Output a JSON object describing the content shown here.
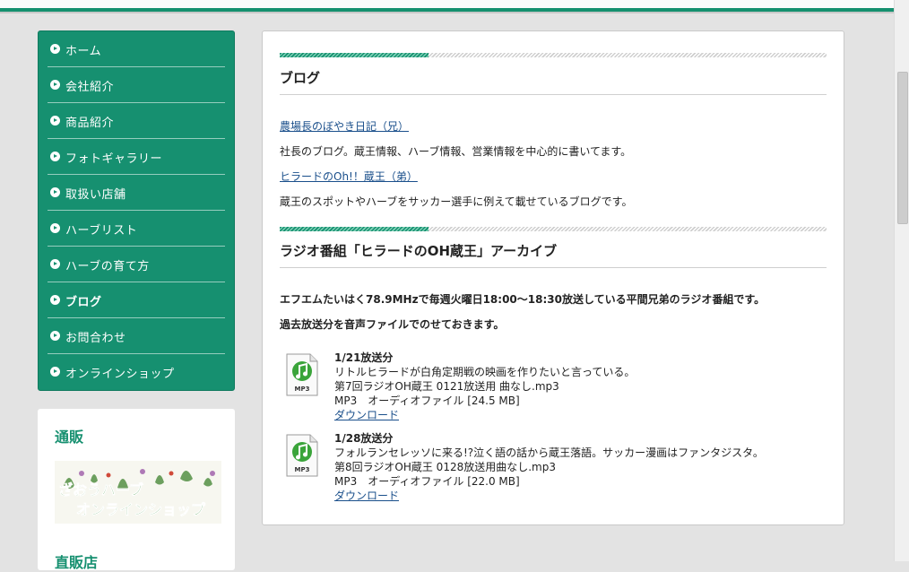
{
  "nav": {
    "items": [
      {
        "label": "ホーム"
      },
      {
        "label": "会社紹介"
      },
      {
        "label": "商品紹介"
      },
      {
        "label": "フォトギャラリー"
      },
      {
        "label": "取扱い店舗"
      },
      {
        "label": "ハーブリスト"
      },
      {
        "label": "ハーブの育て方"
      },
      {
        "label": "ブログ"
      },
      {
        "label": "お問合わせ"
      },
      {
        "label": "オンラインショップ"
      }
    ]
  },
  "sidebar": {
    "mail_order_title": "通販",
    "banner_line1": "ざおうハーブ",
    "banner_line2": "オンラインショップ",
    "next_title": "直販店"
  },
  "blog": {
    "title": "ブログ",
    "entries": [
      {
        "link": "農場長のぼやき日記（兄）",
        "desc": "社長のブログ。蔵王情報、ハーブ情報、営業情報を中心的に書いてます。"
      },
      {
        "link": "ヒラードのOh!！蔵王（弟）",
        "desc": "蔵王のスポットやハーブをサッカー選手に例えて載せているブログです。"
      }
    ]
  },
  "radio": {
    "title": "ラジオ番組「ヒラードのOH蔵王」アーカイブ",
    "intro": "エフエムたいはく78.9MHzで毎週火曜日18:00～18:30放送している平間兄弟のラジオ番組です。",
    "note": "過去放送分を音声ファイルでのせておきます。",
    "files": [
      {
        "title": "1/21放送分",
        "desc": "リトルヒラードが白角定期戦の映画を作りたいと言っている。",
        "filename": "第7回ラジオOH蔵王 0121放送用 曲なし.mp3",
        "type": "MP3　オーディオファイル [24.5 MB]",
        "download": "ダウンロード"
      },
      {
        "title": "1/28放送分",
        "desc": "フォルランセレッソに来る!?泣く語の話から蔵王落語。サッカー漫画はファンタジスタ。",
        "filename": "第8回ラジオOH蔵王 0128放送用曲なし.mp3",
        "type": "MP3　オーディオファイル [22.0 MB]",
        "download": "ダウンロード"
      }
    ],
    "icon_label": "MP3"
  },
  "colors": {
    "accent": "#169070",
    "link": "#1a4f8b"
  }
}
